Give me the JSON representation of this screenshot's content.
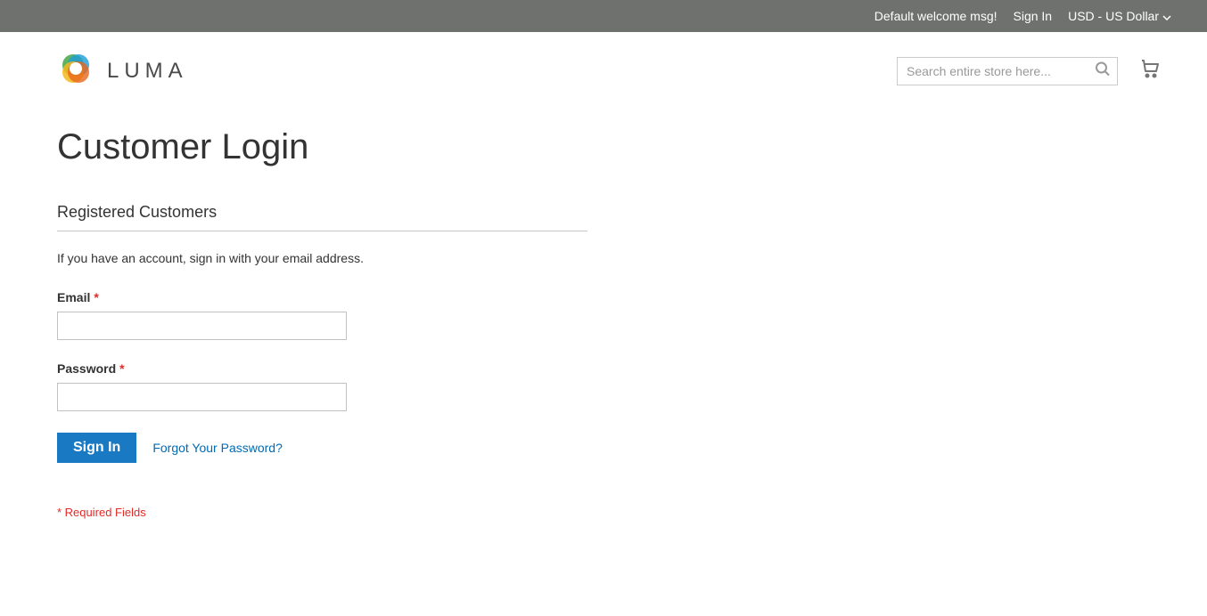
{
  "topbar": {
    "welcome": "Default welcome msg!",
    "sign_in": "Sign In",
    "currency": "USD - US Dollar"
  },
  "header": {
    "logo_text": "LUMA",
    "search_placeholder": "Search entire store here..."
  },
  "page": {
    "title": "Customer Login"
  },
  "login": {
    "block_title": "Registered Customers",
    "note": "If you have an account, sign in with your email address.",
    "email_label": "Email",
    "password_label": "Password",
    "sign_in_button": "Sign In",
    "forgot_link": "Forgot Your Password?",
    "required_note": "* Required Fields"
  }
}
